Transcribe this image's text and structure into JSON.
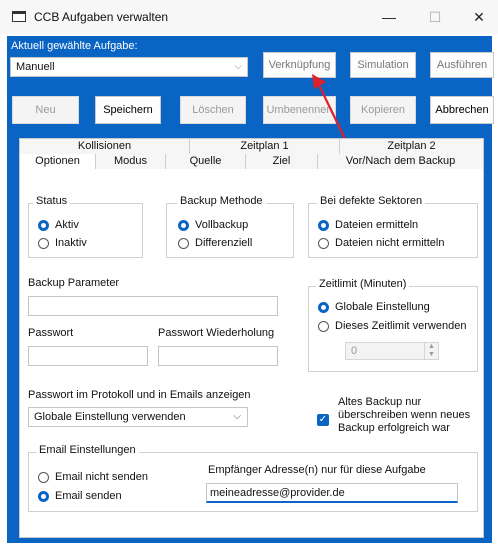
{
  "window": {
    "title": "CCB Aufgaben verwalten",
    "minimize": "—",
    "maximize": "☐",
    "close": "✕"
  },
  "task": {
    "label": "Aktuell gewählte Aufgabe:",
    "value": "Manuell"
  },
  "toolbar": {
    "link": "Verknüpfung",
    "simulation": "Simulation",
    "run": "Ausführen",
    "new": "Neu",
    "save": "Speichern",
    "delete": "Löschen",
    "rename": "Umbenennen",
    "copy": "Kopieren",
    "cancel": "Abbrechen"
  },
  "tabs_top": [
    "Kollisionen",
    "Zeitplan 1",
    "Zeitplan 2"
  ],
  "tabs_bottom": [
    "Optionen",
    "Modus",
    "Quelle",
    "Ziel",
    "Vor/Nach dem Backup"
  ],
  "status": {
    "label": "Status",
    "options": [
      "Aktiv",
      "Inaktiv"
    ],
    "selected": 0
  },
  "method": {
    "label": "Backup Methode",
    "options": [
      "Vollbackup",
      "Differenziell"
    ],
    "selected": 0
  },
  "sectors": {
    "label": "Bei defekte Sektoren",
    "options": [
      "Dateien ermitteln",
      "Dateien nicht ermitteln"
    ],
    "selected": 0
  },
  "params": {
    "label": "Backup Parameter",
    "value": ""
  },
  "password": {
    "label": "Passwort",
    "repeat_label": "Passwort Wiederholung"
  },
  "timelimit": {
    "label": "Zeitlimit (Minuten)",
    "options": [
      "Globale Einstellung",
      "Dieses Zeitlimit verwenden"
    ],
    "selected": 0,
    "value": "0"
  },
  "pw_protocol": {
    "label": "Passwort im Protokoll und in Emails anzeigen",
    "value": "Globale Einstellung verwenden"
  },
  "overwrite": {
    "label": "Altes Backup nur überschreiben wenn neues Backup erfolgreich war",
    "checked": true
  },
  "email": {
    "label": "Email Einstellungen",
    "options": [
      "Email nicht senden",
      "Email senden"
    ],
    "selected": 1,
    "recipient_label": "Empfänger Adresse(n) nur für diese Aufgabe",
    "recipient": "meineadresse@provider.de"
  },
  "colors": {
    "accent": "#0a64c4",
    "arrow": "#e0202a"
  }
}
